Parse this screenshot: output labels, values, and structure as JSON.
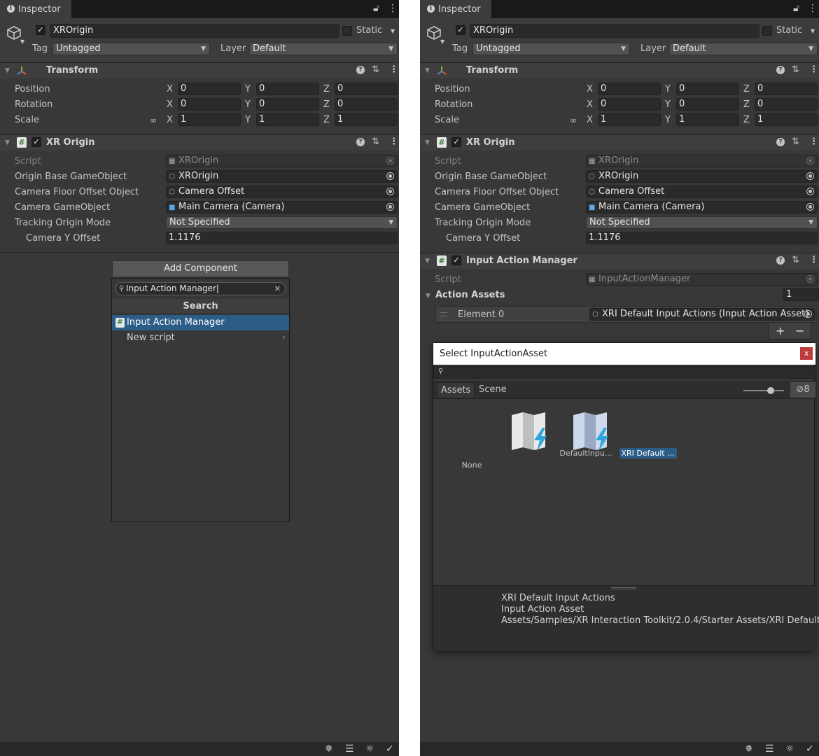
{
  "left": {
    "tab": "Inspector",
    "object_name": "XROrigin",
    "static_label": "Static",
    "tag_label": "Tag",
    "tag_value": "Untagged",
    "layer_label": "Layer",
    "layer_value": "Default",
    "transform": {
      "title": "Transform",
      "rows": [
        {
          "label": "Position",
          "x": "0",
          "y": "0",
          "z": "0"
        },
        {
          "label": "Rotation",
          "x": "0",
          "y": "0",
          "z": "0"
        },
        {
          "label": "Scale",
          "x": "1",
          "y": "1",
          "z": "1"
        }
      ]
    },
    "axes": {
      "x": "X",
      "y": "Y",
      "z": "Z"
    },
    "xr_origin": {
      "title": "XR Origin",
      "script_label": "Script",
      "script_value": "XROrigin",
      "base_label": "Origin Base GameObject",
      "base_value": "XROrigin",
      "floor_label": "Camera Floor Offset Object",
      "floor_value": "Camera Offset",
      "camera_label": "Camera GameObject",
      "camera_value": "Main Camera (Camera)",
      "tracking_label": "Tracking Origin Mode",
      "tracking_value": "Not Specified",
      "offset_label": "Camera Y Offset",
      "offset_value": "1.1176"
    },
    "add_component": {
      "button": "Add Component",
      "search_value": "Input Action Manager",
      "header": "Search",
      "items": [
        "Input Action Manager",
        "New script"
      ]
    }
  },
  "right": {
    "tab": "Inspector",
    "input_action_manager": {
      "title": "Input Action Manager",
      "script_label": "Script",
      "script_value": "InputActionManager",
      "assets_label": "Action Assets",
      "assets_count": "1",
      "element_label": "Element 0",
      "element_value": "XRI Default Input Actions (Input Action Asset)",
      "plus": "+",
      "minus": "−"
    },
    "picker": {
      "title": "Select InputActionAsset",
      "close": "x",
      "tabs": [
        "Assets",
        "Scene"
      ],
      "hidden_count": "8",
      "items": [
        "None",
        "DefaultInpu...",
        "XRI Default ..."
      ],
      "info_lines": [
        "XRI Default Input Actions",
        "Input Action Asset",
        "Assets/Samples/XR Interaction Toolkit/2.0.4/Starter Assets/XRI Default"
      ]
    }
  },
  "icons": {
    "info": "info-icon",
    "lock": "lock-icon",
    "menu": "kebab-menu-icon",
    "gameobject": "cube-icon",
    "transform": "transform-axes-icon",
    "help": "help-icon",
    "presets": "presets-icon",
    "script": "script-icon",
    "link": "constrain-proportions-icon",
    "picker": "object-picker-icon",
    "search": "search-icon",
    "clear": "clear-icon",
    "close": "close-icon",
    "visibility": "hidden-eye-icon",
    "asset": "input-action-asset-icon"
  },
  "colors": {
    "panel": "#383838",
    "field": "#2a2a2a",
    "selection": "#2c5d87",
    "close": "#c0393b"
  }
}
